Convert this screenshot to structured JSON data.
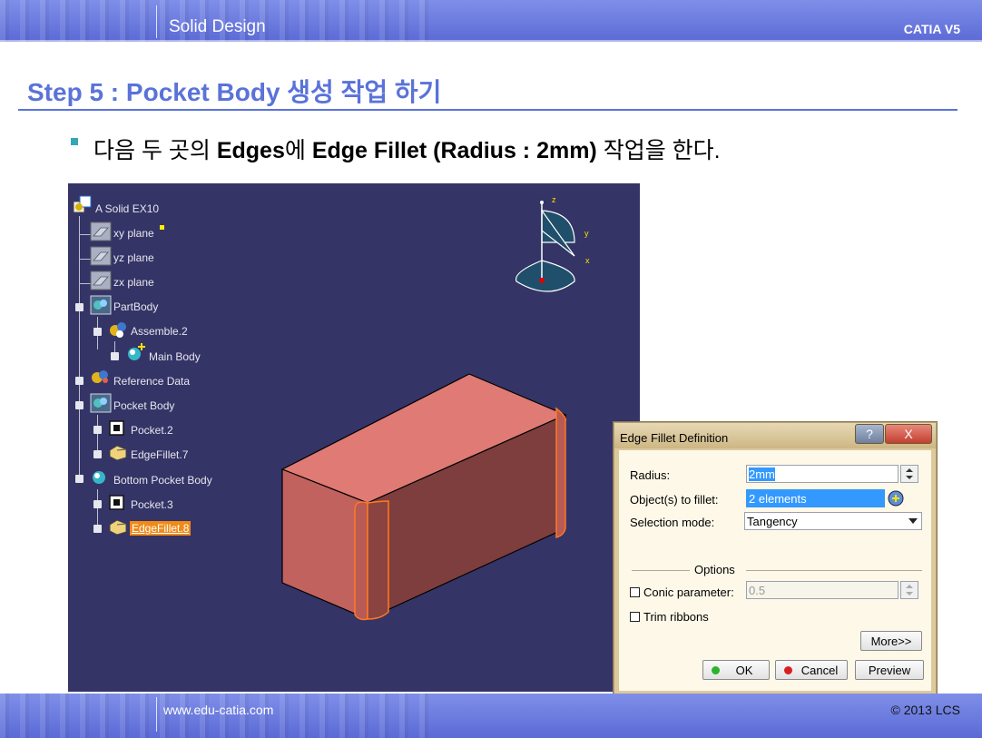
{
  "header": {
    "title": "Solid Design",
    "brand": "CATIA V5"
  },
  "step_title": "Step 5 : Pocket Body 생성 작업 하기",
  "instruction": {
    "p1": "다음 두 곳의 ",
    "b1": "Edges",
    "p2": "에 ",
    "b2": "Edge Fillet (Radius : 2mm)",
    "p3": " 작업을 한다."
  },
  "tree": {
    "root": "A Solid EX10",
    "xy": "xy plane",
    "yz": "yz plane",
    "zx": "zx plane",
    "partbody": "PartBody",
    "assemble": "Assemble.2",
    "mainbody": "Main Body",
    "refdata": "Reference Data",
    "pocketbody": "Pocket Body",
    "pocket2": "Pocket.2",
    "edgefillet7": "EdgeFillet.7",
    "bottompocket": "Bottom Pocket Body",
    "pocket3": "Pocket.3",
    "edgefillet8": "EdgeFillet.8"
  },
  "compass": {
    "z": "z",
    "y": "y",
    "x": "x"
  },
  "dialog": {
    "title": "Edge Fillet Definition",
    "help": "?",
    "close": "X",
    "radius_label": "Radius:",
    "radius_value": "2mm",
    "objects_label": "Object(s) to fillet:",
    "objects_value": "2 elements",
    "selection_label": "Selection mode:",
    "selection_value": "Tangency",
    "options_label": "Options",
    "conic_label": "Conic parameter:",
    "conic_value": "0.5",
    "trim_label": "Trim ribbons",
    "more": "More>>",
    "ok": "OK",
    "cancel": "Cancel",
    "preview": "Preview"
  },
  "footer": {
    "url": "www.edu-catia.com",
    "copyright": "© 2013 LCS"
  },
  "colors": {
    "accent": "#5a73d8",
    "viewer_bg": "#353467",
    "part": "#d86f6f",
    "dialog": "#dcc99c"
  }
}
